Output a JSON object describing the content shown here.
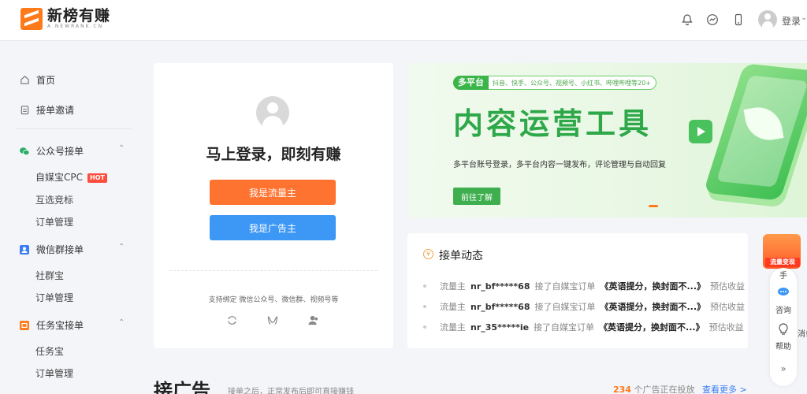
{
  "header": {
    "logo_cn": "新榜有赚",
    "logo_en": "A.NEWRANK.CN",
    "login": "登录"
  },
  "sidebar": {
    "home": "首页",
    "invite": "接单邀请",
    "groups": [
      {
        "title": "公众号接单",
        "items": [
          "自媒宝CPC",
          "互选竞标",
          "订单管理"
        ],
        "hot": "HOT"
      },
      {
        "title": "微信群接单",
        "items": [
          "社群宝",
          "订单管理"
        ]
      },
      {
        "title": "任务宝接单",
        "items": [
          "任务宝",
          "订单管理"
        ]
      }
    ]
  },
  "login_card": {
    "title": "马上登录，即刻有赚",
    "btn_traffic": "我是流量主",
    "btn_advertiser": "我是广告主",
    "bind_text": "支持绑定 微信公众号、微信群、视频号等"
  },
  "banner": {
    "tag_main": "多平台",
    "tag_sub": "抖音、快手、公众号、视频号、小红书、哔哩哔哩等20+",
    "title": "内容运营工具",
    "desc": "多平台账号登录，多平台内容一键发布，评论管理与自动回复",
    "button": "前往了解"
  },
  "activity": {
    "title": "接单动态",
    "rows": [
      {
        "role": "流量主",
        "name": "nr_bf*****68",
        "action": "接了自媒宝订单",
        "article": "《英语提分，换封面不...》",
        "tail": "预估收益"
      },
      {
        "role": "流量主",
        "name": "nr_bf*****68",
        "action": "接了自媒宝订单",
        "article": "《英语提分，换封面不...》",
        "tail": "预估收益"
      },
      {
        "role": "流量主",
        "name": "nr_35*****ie",
        "action": "接了自媒宝订单",
        "article": "《英语提分，换封面不...》",
        "tail": "预估收益"
      }
    ]
  },
  "float": {
    "promo": "流量变现",
    "promo_sub": "手",
    "consult": "咨询",
    "help": "帮助",
    "msg": "消!"
  },
  "section": {
    "title": "接广告",
    "sub": "接单之后，正常发布后即可直接赚钱",
    "count_num": "234",
    "count_text": " 个广告正在投放",
    "more": "查看更多 >"
  },
  "colors": {
    "accent": "#ff7330",
    "blue": "#3c97f5",
    "green": "#2fa84a"
  }
}
